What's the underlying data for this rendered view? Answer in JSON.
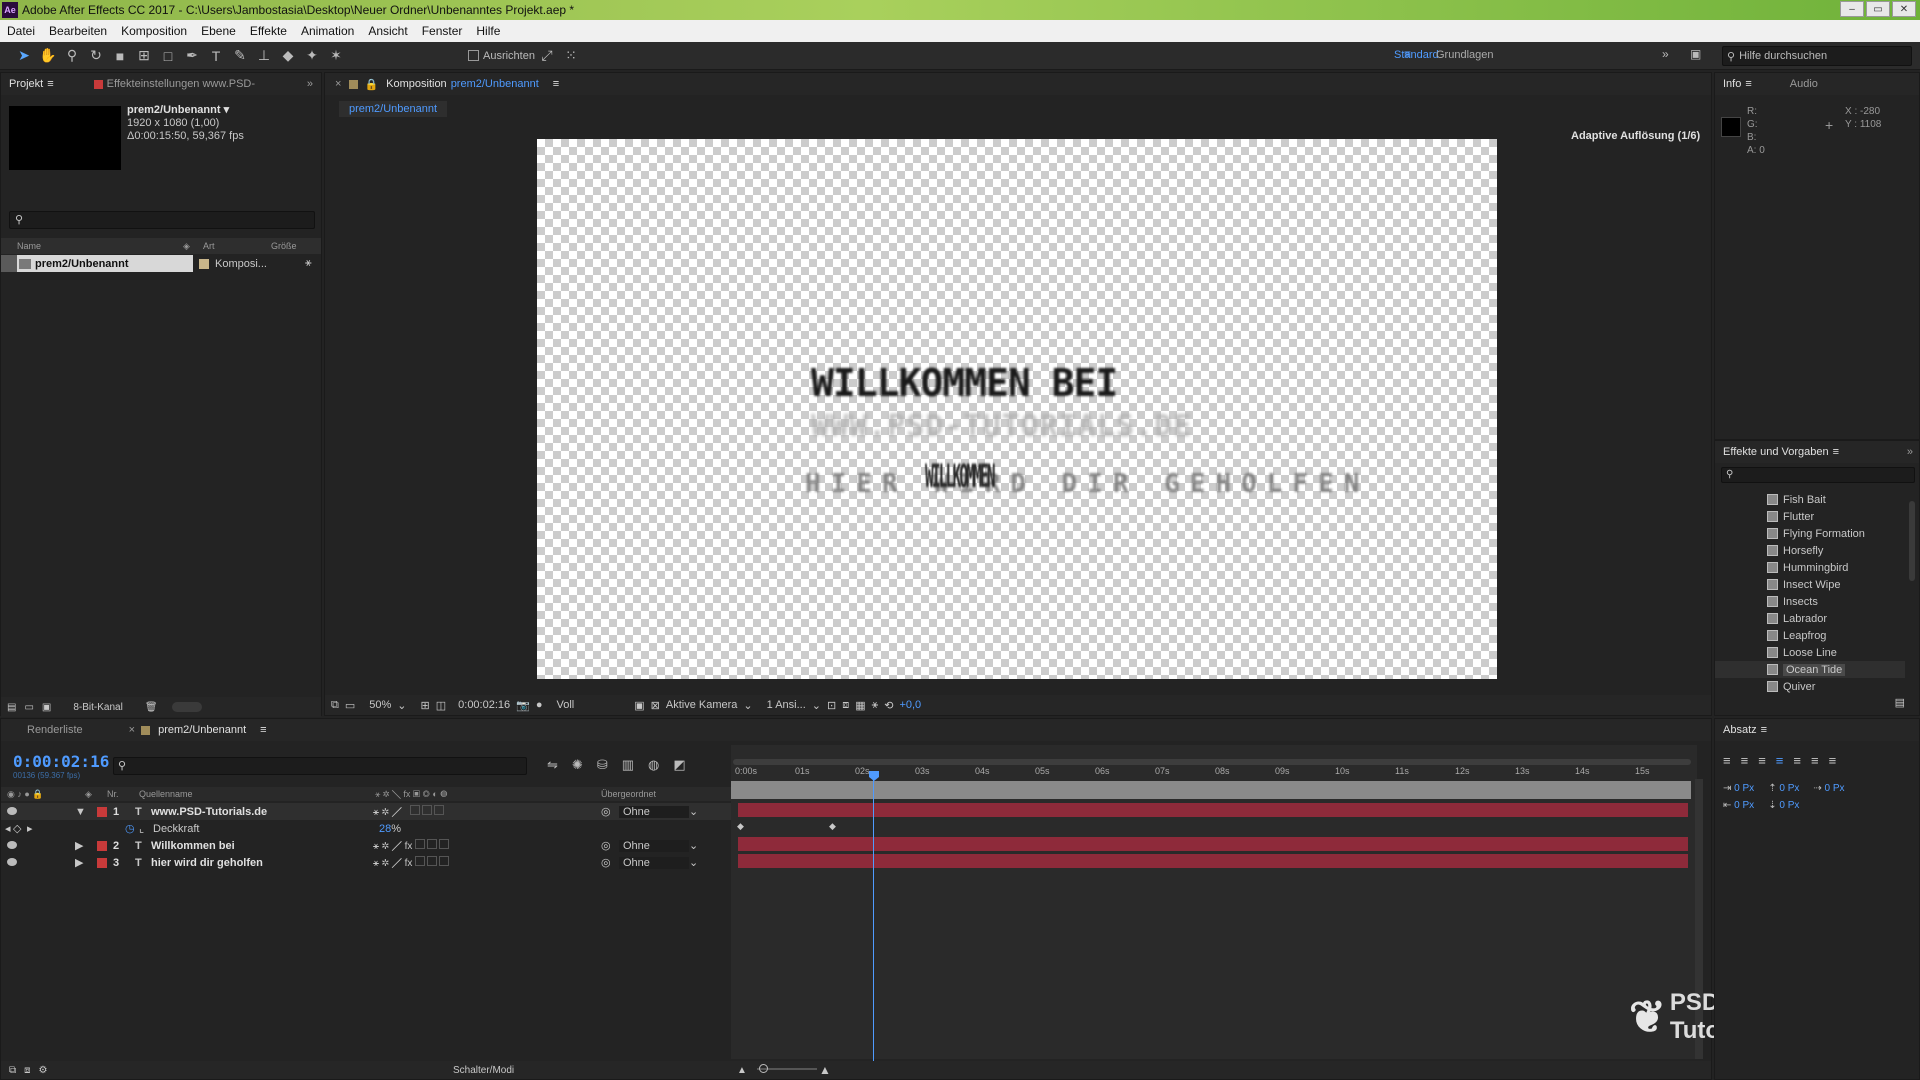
{
  "window": {
    "title": "Adobe After Effects CC 2017 - C:\\Users\\Jambostasia\\Desktop\\Neuer Ordner\\Unbenanntes Projekt.aep *",
    "logo": "Ae",
    "min": "–",
    "max": "▭",
    "close": "✕"
  },
  "menu": [
    "Datei",
    "Bearbeiten",
    "Komposition",
    "Ebene",
    "Effekte",
    "Animation",
    "Ansicht",
    "Fenster",
    "Hilfe"
  ],
  "toolbar": {
    "snap_label": "Ausrichten",
    "workspace_active": "Standard",
    "workspace_other": "Grundlagen",
    "search_placeholder": "Hilfe durchsuchen"
  },
  "project": {
    "tab": "Projekt",
    "effects_tab": "Effekteinstellungen www.PSD-",
    "comp_name": "prem2/Unbenannt",
    "comp_res": "1920 x 1080 (1,00)",
    "comp_dur": "Δ0:00:15:50, 59,367 fps",
    "columns": {
      "name": "Name",
      "type": "Art",
      "size": "Größe"
    },
    "items": [
      {
        "name": "prem2/Unbenannt",
        "type": "Komposi..."
      }
    ],
    "bitdepth": "8-Bit-Kanal"
  },
  "comp": {
    "tab_prefix": "Komposition",
    "tab_name": "prem2/Unbenannt",
    "breadcrumb": "prem2/Unbenannt",
    "adaptive": "Adaptive Auflösung (1/6)",
    "text_line1": "WILLKOMMEN BEI",
    "text_line2": "WWW.PSD-TUTORIALS.DE",
    "text_line3": "HIER WIRD DIR GEHOLFEN",
    "text_overlay": "WILLKOMMEN",
    "zoom": "50%",
    "timecode": "0:00:02:16",
    "quality": "Voll",
    "camera": "Aktive Kamera",
    "views": "1 Ansi...",
    "exposure": "+0,0"
  },
  "info": {
    "tab": "Info",
    "audio_tab": "Audio",
    "r": "R:",
    "g": "G:",
    "b": "B:",
    "a": "A:  0",
    "x": "X : -280",
    "y": "Y : 1108"
  },
  "effects": {
    "tab": "Effekte und Vorgaben",
    "items": [
      "Fish Bait",
      "Flutter",
      "Flying Formation",
      "Horsefly",
      "Hummingbird",
      "Insect Wipe",
      "Insects",
      "Labrador",
      "Leapfrog",
      "Loose Line",
      "Ocean Tide",
      "Quiver"
    ],
    "selected": "Ocean Tide"
  },
  "paragraph": {
    "tab": "Absatz",
    "indent": [
      "0 Px",
      "0 Px",
      "0 Px",
      "0 Px",
      "0 Px"
    ]
  },
  "timeline": {
    "render_tab": "Renderliste",
    "comp_tab": "prem2/Unbenannt",
    "timecode": "0:00:02:16",
    "frames": "00136 (59.367 fps)",
    "columns": {
      "nr": "Nr.",
      "source": "Quellenname",
      "parent": "Übergeordnet"
    },
    "layers": [
      {
        "nr": "1",
        "name": "www.PSD-Tutorials.de",
        "parent": "Ohne"
      },
      {
        "nr": "2",
        "name": "Willkommen bei",
        "parent": "Ohne"
      },
      {
        "nr": "3",
        "name": "hier wird dir geholfen",
        "parent": "Ohne"
      }
    ],
    "prop_name": "Deckkraft",
    "prop_value": "28",
    "prop_unit": "%",
    "ticks": [
      "0:00s",
      "01s",
      "02s",
      "03s",
      "04s",
      "05s",
      "06s",
      "07s",
      "08s",
      "09s",
      "10s",
      "11s",
      "12s",
      "13s",
      "14s",
      "15s"
    ],
    "switch_mode": "Schalter/Modi"
  },
  "watermark": "PSD-Tutorials.de",
  "colors": {
    "accent": "#4f9bff",
    "layer_bar": "#8e2a3a",
    "label_red": "#c83a3a"
  }
}
